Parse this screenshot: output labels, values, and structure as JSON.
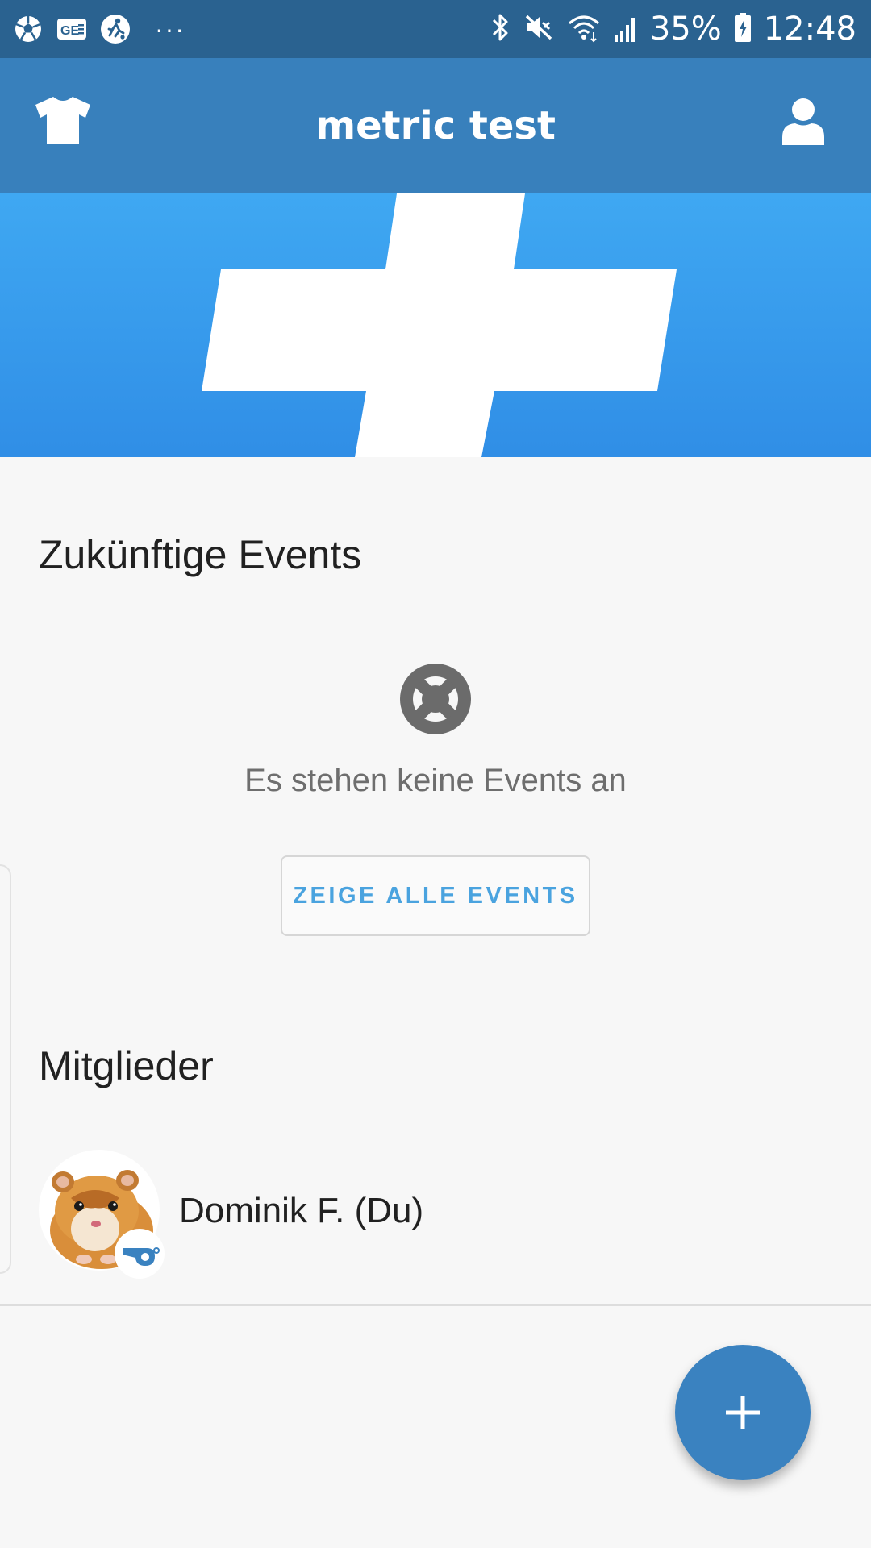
{
  "status_bar": {
    "icons_left": [
      "soccer-ball-icon",
      "news-icon",
      "soccer-player-icon"
    ],
    "more": "···",
    "icons_right": [
      "bluetooth-icon",
      "mute-icon",
      "wifi-icon",
      "signal-icon",
      "battery-charging-icon"
    ],
    "battery": "35%",
    "time": "12:48"
  },
  "app_bar": {
    "title": "metric test",
    "left_icon": "jersey-icon",
    "right_icon": "user-icon"
  },
  "banner": {
    "graphic": "plus-logo",
    "background": "#3a9ff0"
  },
  "events": {
    "heading": "Zukünftige Events",
    "empty_icon": "lifebuoy-icon",
    "empty_text": "Es stehen keine Events an",
    "show_all_label": "ZEIGE ALLE EVENTS"
  },
  "members": {
    "heading": "Mitglieder",
    "items": [
      {
        "name": "Dominik F. (Du)",
        "avatar": "hamster-photo",
        "role_icon": "whistle-icon"
      }
    ]
  },
  "fab": {
    "icon": "plus-icon"
  },
  "colors": {
    "status_bar": "#2a6290",
    "app_bar": "#3880bc",
    "accent": "#4aa3df",
    "fab": "#3a82c0"
  }
}
